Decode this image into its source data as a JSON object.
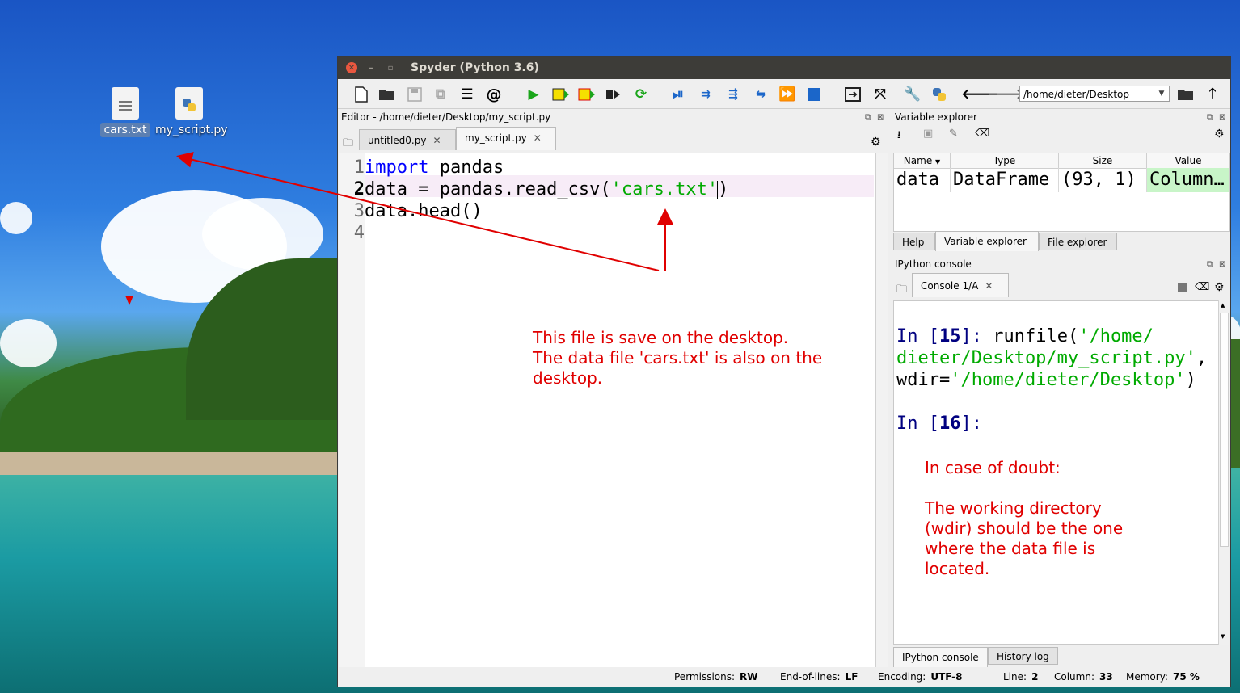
{
  "desktop": {
    "icons": [
      {
        "label": "cars.txt",
        "icon": "text-file-icon",
        "selected": true
      },
      {
        "label": "my_script.py",
        "icon": "python-file-icon",
        "selected": false
      }
    ]
  },
  "window": {
    "title": "Spyder (Python 3.6)",
    "path": "/home/dieter/Desktop"
  },
  "editor": {
    "title": "Editor - /home/dieter/Desktop/my_script.py",
    "tabs": [
      {
        "label": "untitled0.py"
      },
      {
        "label": "my_script.py",
        "active": true
      }
    ],
    "lines": [
      {
        "n": "1",
        "parts": [
          [
            "kw",
            "import"
          ],
          [
            "",
            ""
          ],
          [
            "",
            " pandas"
          ]
        ]
      },
      {
        "n": "2",
        "parts": [
          [
            "",
            "data = pandas.read_csv("
          ],
          [
            "str",
            "'cars.txt'"
          ],
          [
            "",
            ")"
          ]
        ]
      },
      {
        "n": "3",
        "parts": [
          [
            "",
            "data.head()"
          ]
        ]
      },
      {
        "n": "4",
        "parts": []
      }
    ],
    "annotation": "This file is save on the desktop.\nThe data file 'cars.txt' is also on the\ndesktop."
  },
  "variable_explorer": {
    "title": "Variable explorer",
    "columns": [
      "Name",
      "Type",
      "Size",
      "Value"
    ],
    "rows": [
      {
        "name": "data",
        "type": "DataFrame",
        "size": "(93, 1)",
        "value": "Column…"
      }
    ],
    "bottom_tabs": [
      "Help",
      "Variable explorer",
      "File explorer"
    ]
  },
  "console": {
    "title": "IPython console",
    "tab": "Console 1/A",
    "in15_num": "15",
    "in15_code1": "runfile(",
    "in15_str1": "'/home/",
    "in15_line2": "dieter/Desktop/my_script.py'",
    "in15_line2_tail": ",",
    "in15_line3a": "wdir=",
    "in15_line3b": "'/home/dieter/Desktop'",
    "in15_line3c": ")",
    "in16_num": "16",
    "prompt_in": "In [",
    "prompt_close": "]: ",
    "prompt_close16": "]:",
    "annotation": "In case of doubt:\n\nThe working directory\n(wdir) should be the one\nwhere the data file is\nlocated.",
    "bottom_tabs": [
      "IPython console",
      "History log"
    ]
  },
  "statusbar": {
    "permissions_label": "Permissions:",
    "permissions": "RW",
    "eol_label": "End-of-lines:",
    "eol": "LF",
    "encoding_label": "Encoding:",
    "encoding": "UTF-8",
    "line_label": "Line:",
    "line": "2",
    "column_label": "Column:",
    "column": "33",
    "memory_label": "Memory:",
    "memory": "75 %"
  },
  "colors": {
    "annotation": "#e00000",
    "run_green": "#1aa51a",
    "string_green": "#00aa00",
    "keyword_blue": "#0000ff",
    "title_bar": "#3d3c38"
  }
}
